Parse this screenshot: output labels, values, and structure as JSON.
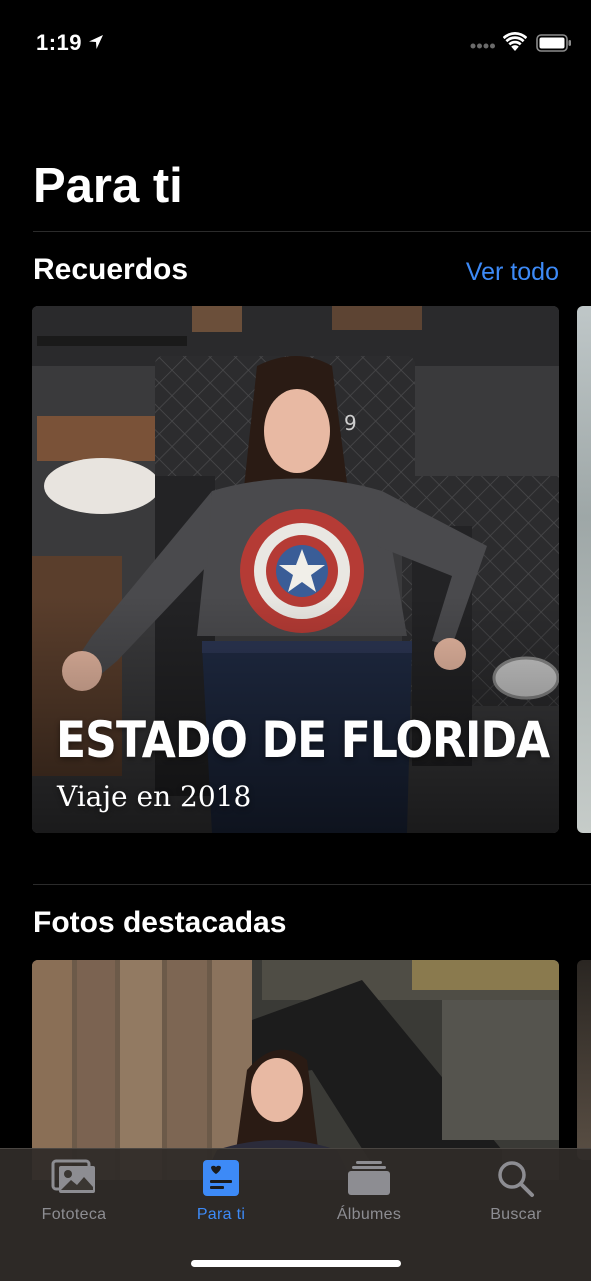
{
  "status_bar": {
    "time": "1:19"
  },
  "header": {
    "title": "Para ti"
  },
  "memories": {
    "title": "Recuerdos",
    "see_all": "Ver todo",
    "card": {
      "title": "ESTADO DE FLORIDA",
      "subtitle": "Viaje en 2018"
    }
  },
  "featured": {
    "title": "Fotos destacadas"
  },
  "tab_bar": {
    "items": [
      {
        "label": "Fototeca",
        "icon": "photos-library-icon",
        "active": false
      },
      {
        "label": "Para ti",
        "icon": "for-you-icon",
        "active": true
      },
      {
        "label": "Álbumes",
        "icon": "albums-icon",
        "active": false
      },
      {
        "label": "Buscar",
        "icon": "search-icon",
        "active": false
      }
    ]
  },
  "colors": {
    "accent": "#3d8af7",
    "background": "#000000",
    "inactive_tab": "#8d8d92"
  }
}
